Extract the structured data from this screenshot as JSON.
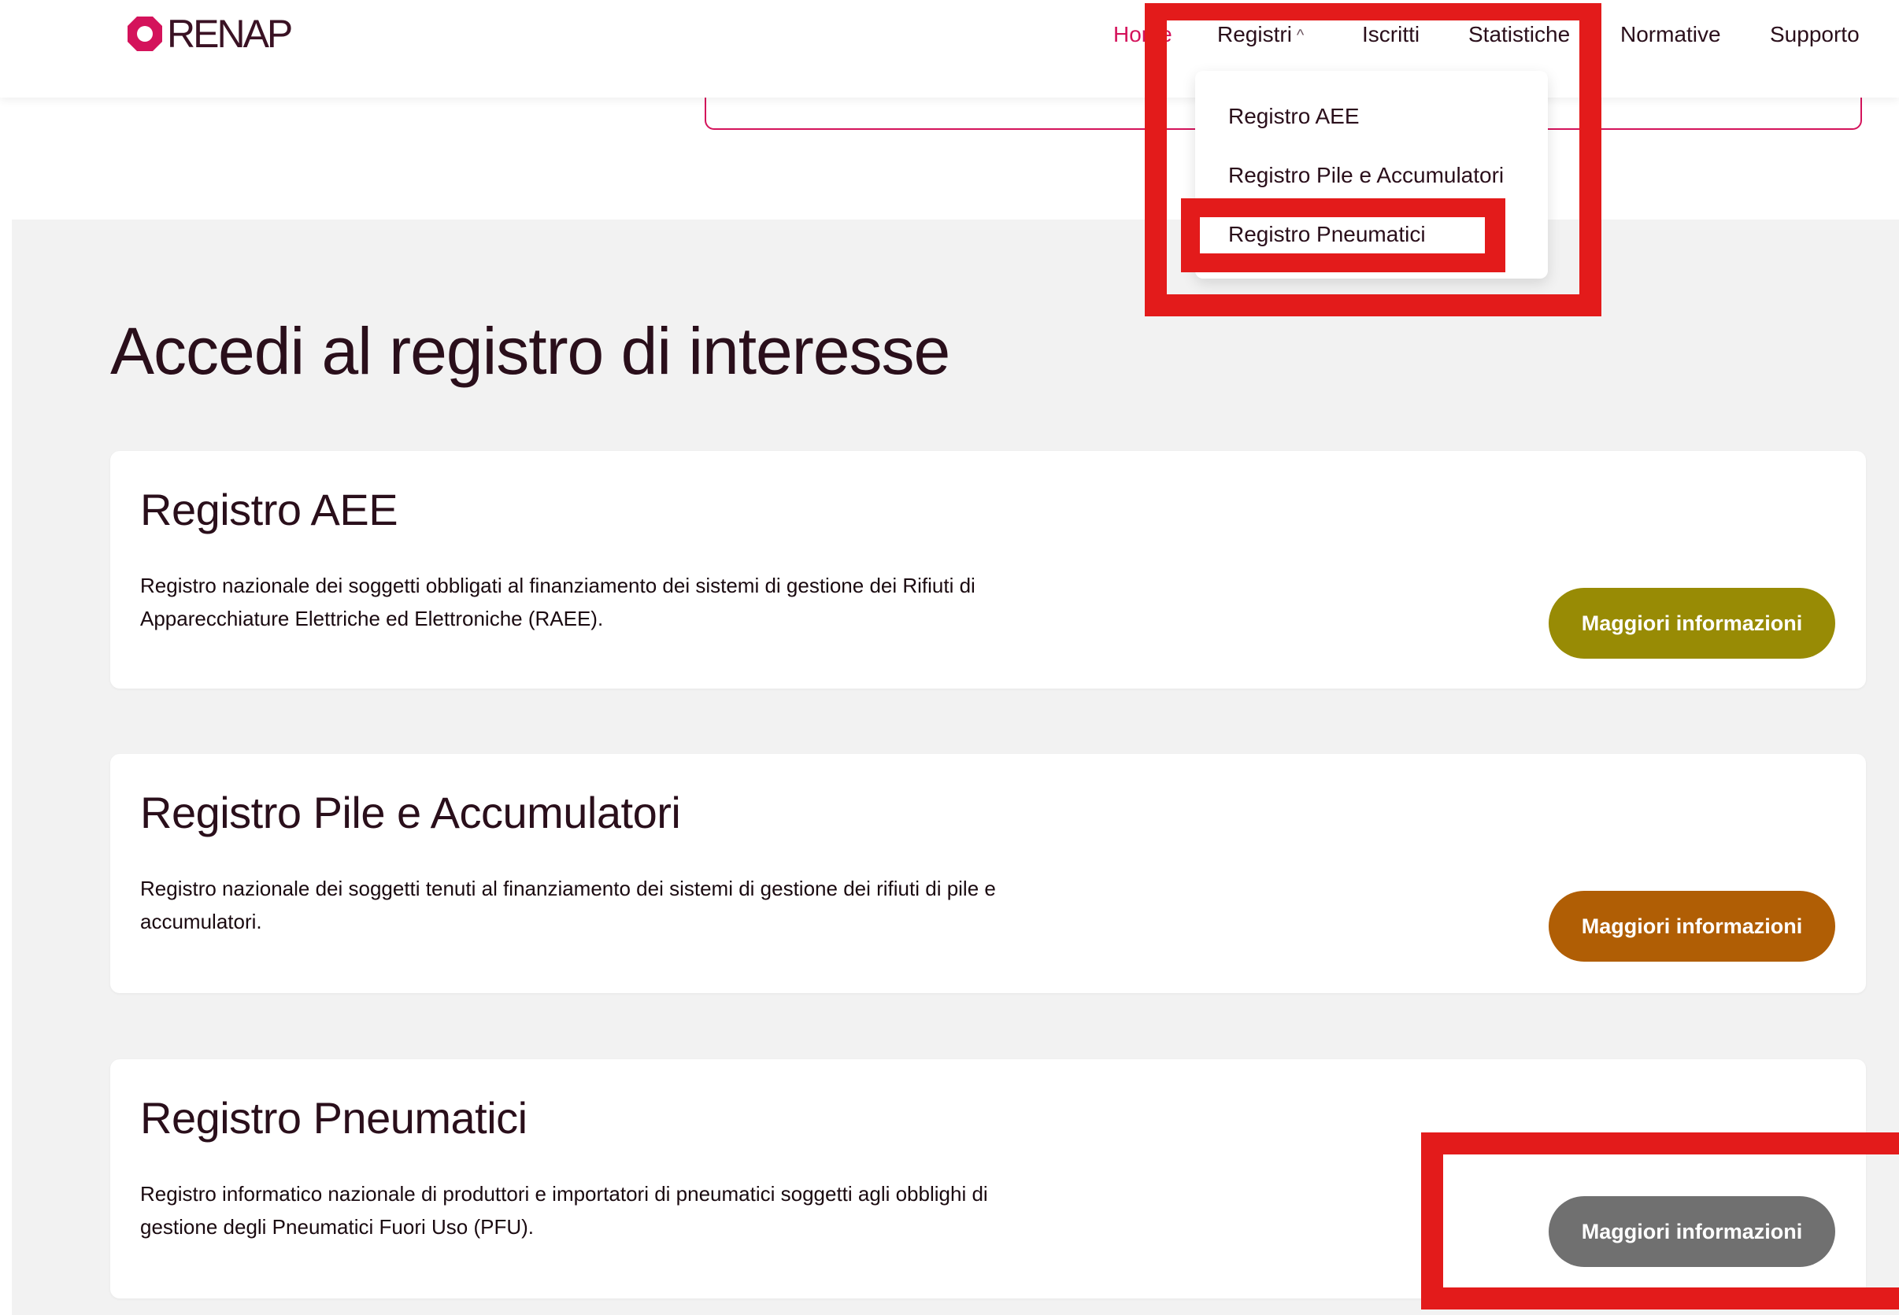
{
  "header": {
    "logo_text": "RENAP",
    "nav": [
      {
        "label": "Home"
      },
      {
        "label": "Registri"
      },
      {
        "label": "Iscritti"
      },
      {
        "label": "Statistiche"
      },
      {
        "label": "Normative"
      },
      {
        "label": "Supporto"
      }
    ]
  },
  "dropdown": {
    "items": [
      {
        "label": "Registro AEE"
      },
      {
        "label": "Registro Pile e Accumulatori"
      },
      {
        "label": "Registro Pneumatici"
      }
    ]
  },
  "main": {
    "title": "Accedi al registro di interesse",
    "cards": [
      {
        "title": "Registro AEE",
        "description": "Registro nazionale dei soggetti obbligati al finanziamento dei sistemi di gestione dei Rifiuti di Apparecchiature Elettriche ed Elettroniche (RAEE).",
        "button_label": "Maggiori informazioni",
        "button_color": "#988b05"
      },
      {
        "title": "Registro Pile e Accumulatori",
        "description": "Registro nazionale dei soggetti tenuti al finanziamento dei sistemi di gestione dei rifiuti di pile e accumulatori.",
        "button_label": "Maggiori informazioni",
        "button_color": "#b05e05"
      },
      {
        "title": "Registro Pneumatici",
        "description": "Registro informatico nazionale di produttori e importatori di pneumatici soggetti agli obblighi di gestione degli Pneumatici Fuori Uso (PFU).",
        "button_label": "Maggiori informazioni",
        "button_color": "#707070"
      }
    ]
  },
  "colors": {
    "brand": "#d4135b",
    "annotation": "#e31b1b",
    "background": "#f2f2f2"
  },
  "icons": {
    "logo": "renap-logo-icon",
    "registri_toggle": "chevron-up-icon"
  }
}
